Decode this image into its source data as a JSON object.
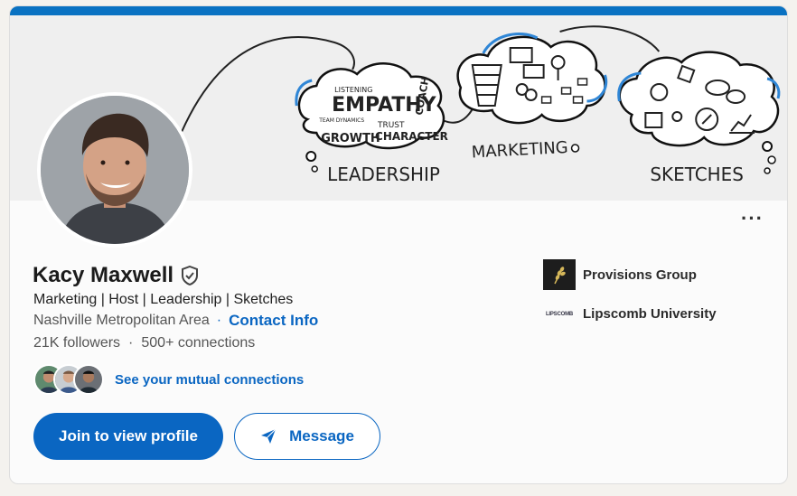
{
  "profile": {
    "name": "Kacy Maxwell",
    "headline": "Marketing | Host | Leadership | Sketches",
    "location": "Nashville Metropolitan Area",
    "contact_label": "Contact Info",
    "followers": "21K followers",
    "connections": "500+ connections",
    "mutual_label": "See your mutual connections"
  },
  "banner": {
    "words": [
      "EMPATHY",
      "LISTENING",
      "TEAM DYNAMICS",
      "GROWTH",
      "TRUST",
      "CHARACTER",
      "COACH",
      "LEADERSHIP",
      "MARKETING",
      "SKETCHES"
    ]
  },
  "actions": {
    "join_label": "Join to view profile",
    "message_label": "Message",
    "more_label": "···"
  },
  "organizations": [
    {
      "name": "Provisions Group"
    },
    {
      "name": "Lipscomb University",
      "logo_text": "LIPSCOMB"
    }
  ],
  "colors": {
    "accent": "#0a66c2",
    "top_bar": "#0a72c2"
  }
}
